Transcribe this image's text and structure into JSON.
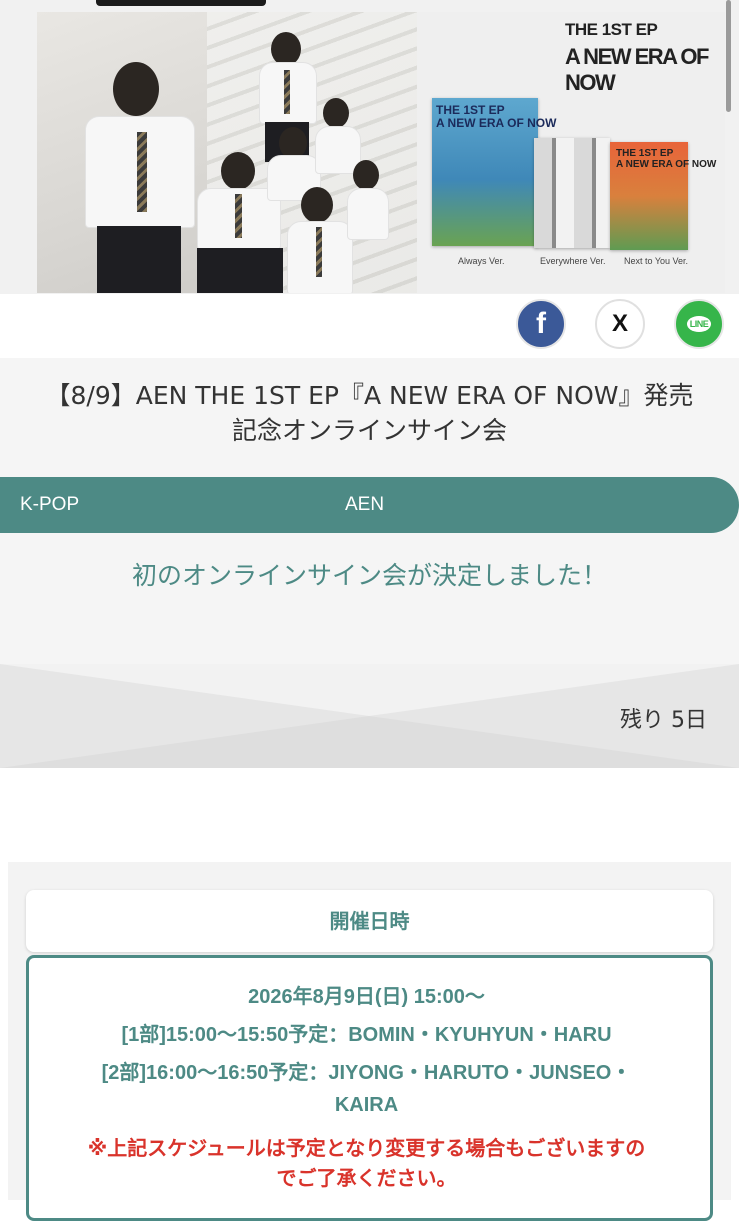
{
  "banner": {
    "ep_title_small": "THE 1ST EP",
    "ep_title_big": "A NEW ERA OF NOW",
    "album_versions": [
      "Always Ver.",
      "Everywhere Ver.",
      "Next to You Ver."
    ]
  },
  "share": {
    "facebook_icon": "facebook-icon",
    "facebook_glyph": "f",
    "x_icon": "x-icon",
    "x_glyph": "X",
    "line_icon": "line-icon",
    "line_glyph": "LINE"
  },
  "event": {
    "title_line1": "【8/9】AEN THE 1ST EP『A NEW ERA OF NOW』発売",
    "title_line2": "記念オンラインサイン会",
    "category": "K-POP",
    "artist": "AEN",
    "announcement": "初のオンラインサイン会が決定しました！",
    "remaining": "残り 5日"
  },
  "schedule": {
    "header": "開催日時",
    "date": "2026年8月9日(日) 15:00〜",
    "part1": "[1部]15:00〜15:50予定：BOMIN・KYUHYUN・HARU",
    "part2": "[2部]16:00〜16:50予定：JIYONG・HARUTO・JUNSEO・",
    "part2_cont": "KAIRA",
    "note_line1": "※上記スケジュールは予定となり変更する場合もございますの",
    "note_line2": "でご了承ください。"
  },
  "colors": {
    "accent": "#4d8a85",
    "warning": "#d9332b",
    "facebook": "#3b5998",
    "line": "#36b54a"
  }
}
